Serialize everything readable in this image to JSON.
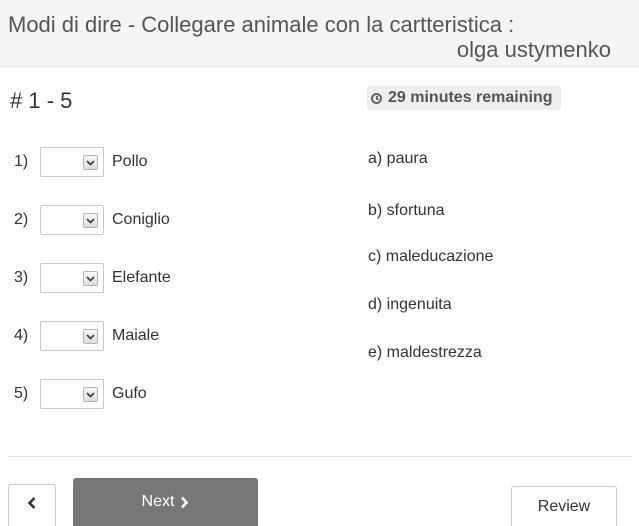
{
  "header": {
    "title_line1": "Modi di dire - Collegare animale con la cartteristica :",
    "title_line2": "olga ustymenko"
  },
  "question_range": "# 1 - 5",
  "timer": {
    "text": "29 minutes remaining",
    "icon": "clock-icon"
  },
  "left_items": [
    {
      "number": "1)",
      "label": "Pollo",
      "selected": ""
    },
    {
      "number": "2)",
      "label": "Coniglio",
      "selected": ""
    },
    {
      "number": "3)",
      "label": "Elefante",
      "selected": ""
    },
    {
      "number": "4)",
      "label": "Maiale",
      "selected": ""
    },
    {
      "number": "5)",
      "label": "Gufo",
      "selected": ""
    }
  ],
  "right_items": [
    "a) paura",
    "b) sfortuna",
    "c) maleducazione",
    "d) ingenuita",
    "e) maldestrezza"
  ],
  "footer": {
    "prev_icon": "chevron-left-icon",
    "next_label": "Next",
    "next_icon": "chevron-right-icon",
    "review_label": "Review"
  },
  "colors": {
    "header_bg": "#f5f5f5",
    "next_button_bg": "#777777",
    "timer_bg": "#eeeeee"
  }
}
